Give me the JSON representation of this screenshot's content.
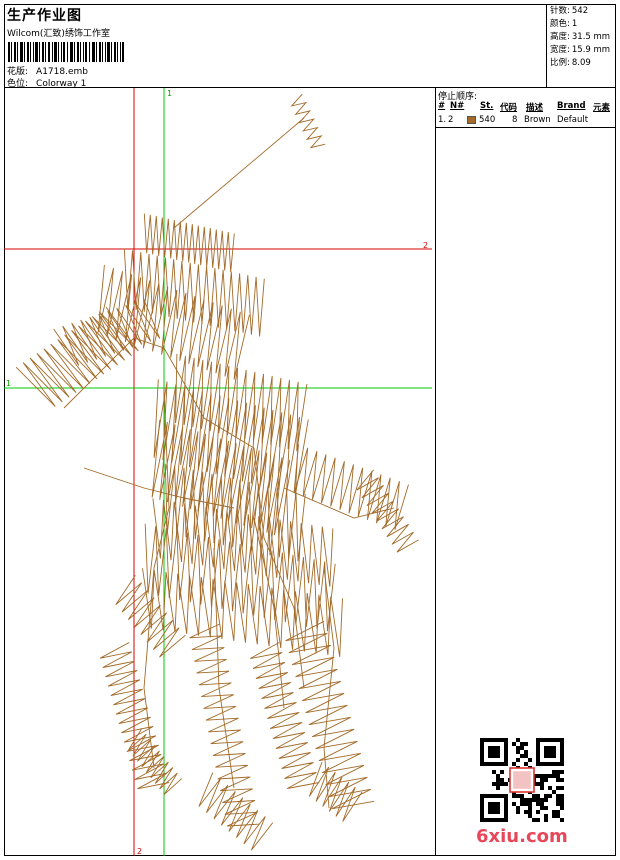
{
  "header": {
    "title": "生产作业图",
    "company": "Wilcom(汇致)绣饰工作室",
    "pattern_label": "花版:",
    "pattern_value": "A1718.emb",
    "color_label": "色位:",
    "color_value": "Colorway 1"
  },
  "stats": [
    {
      "label": "针数:",
      "value": "542"
    },
    {
      "label": "颜色:",
      "value": "1"
    },
    {
      "label": "高度:",
      "value": "31.5 mm"
    },
    {
      "label": "宽度:",
      "value": "15.9 mm"
    },
    {
      "label": "比例:",
      "value": "8.09"
    }
  ],
  "guides": {
    "vertical_red_label": "2",
    "horizontal_red_label": "2",
    "vertical_green_label": "1",
    "horizontal_green_label": "1"
  },
  "stop_sequence": {
    "title": "停止顺序:",
    "headers": [
      "#",
      "N#",
      "St.",
      "代码",
      "描述",
      "Brand",
      "元素"
    ],
    "rows": [
      {
        "num": "1.",
        "n": "2",
        "stitches": "540",
        "code": "8",
        "desc": "Brown",
        "brand": "Default",
        "element": ""
      }
    ]
  },
  "colors": {
    "thread": "#a36a28",
    "guide_red": "#d40000",
    "guide_green": "#00c800"
  },
  "watermark": "6xiu.com"
}
